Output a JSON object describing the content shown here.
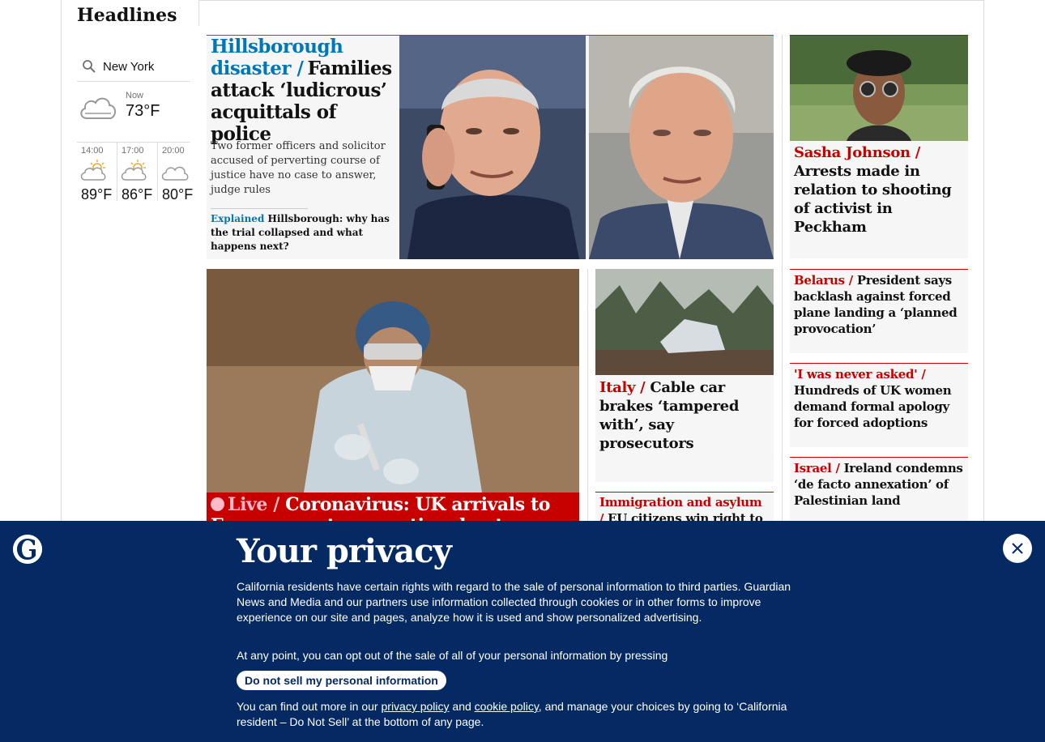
{
  "sidebar": {
    "title": "Headlines",
    "location": "New York",
    "now": {
      "label": "Now",
      "temp": "73°F",
      "icon": "cloud-icon"
    },
    "forecast": [
      {
        "time": "14:00",
        "temp": "89°F",
        "icon": "sun-cloud-icon"
      },
      {
        "time": "17:00",
        "temp": "86°F",
        "icon": "sun-cloud-icon"
      },
      {
        "time": "20:00",
        "temp": "80°F",
        "icon": "cloud-icon"
      }
    ]
  },
  "hero": {
    "kicker": "Hillsborough disaster /",
    "headline": "Families attack ‘ludicrous’ acquittals of police",
    "standfirst": "Two former officers and solicitor accused of perverting course of justice have no case to answer, judge rules",
    "related_kicker": "Explained",
    "related_text": "Hillsborough: why has the trial collapsed and what happens next?"
  },
  "right_cards": [
    {
      "kicker": "Sasha Johnson  /",
      "headline": "Arrests made in relation to shooting of activist in Peckham"
    },
    {
      "kicker": "Belarus /",
      "headline": "President says backlash against forced plane landing a ‘planned provocation’"
    },
    {
      "kicker": "'I was never asked' /",
      "headline": "Hundreds of UK women demand formal apology for forced adoptions"
    },
    {
      "kicker": "Israel /",
      "headline": "Ireland condemns ‘de facto annexation’ of Palestinian land"
    }
  ],
  "mid_cards": [
    {
      "kicker": "Italy /",
      "headline": "Cable car brakes ‘tampered with’, say prosecutors"
    },
    {
      "kicker": "Immigration and asylum /",
      "headline": "EU citizens win right to"
    }
  ],
  "live_card": {
    "kicker": "Live /",
    "headline": "Coronavirus: UK arrivals to Europe must quarantine due to Indian"
  },
  "privacy": {
    "title": "Your privacy",
    "body1": "California residents have certain rights with regard to the sale of personal information to third parties. Guardian News and Media and our partners use information collected through cookies or in other forms to improve experience on our site and pages, analyze how it is used and show personalized advertising.",
    "body2": "At any point, you can opt out of the sale of all of your personal information by pressing",
    "button": "Do not sell my personal information",
    "body3_pre": "You can find out more in our ",
    "privacy_link": "privacy policy",
    "body3_and": " and ",
    "cookie_link": "cookie policy",
    "body3_post": ", and manage your choices by going to ‘California resident – Do Not Sell’ at the bottom of any page."
  },
  "colors": {
    "news_red": "#c70000",
    "hero_blue": "#0077b6",
    "banner_navy": "#052962",
    "live_pink": "#ffbac8"
  }
}
